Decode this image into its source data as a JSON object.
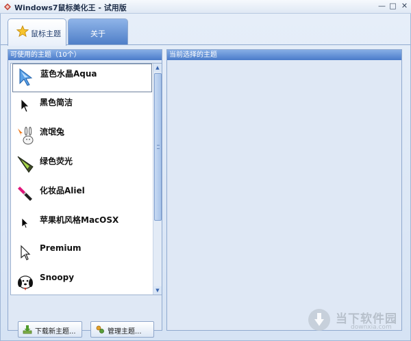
{
  "window": {
    "title": "Windows7鼠标美化王 - 试用版",
    "minimize_glyph": "—",
    "maximize_glyph": "□",
    "close_glyph": "✕"
  },
  "tabs": [
    {
      "label": "鼠标主题",
      "icon": "star-icon",
      "active": true
    },
    {
      "label": "关于",
      "active": false
    }
  ],
  "available_panel": {
    "header": "可使用的主题（10个）",
    "themes": [
      {
        "name": "蓝色水晶Aqua",
        "icon": "aqua-cursor-icon",
        "selected": true
      },
      {
        "name": "黑色简洁",
        "icon": "black-arrow-cursor-icon",
        "selected": false
      },
      {
        "name": "流氓兔",
        "icon": "rabbit-cursor-icon",
        "selected": false
      },
      {
        "name": "绿色荧光",
        "icon": "green-glow-cursor-icon",
        "selected": false
      },
      {
        "name": "化妆品Aliel",
        "icon": "lipstick-cursor-icon",
        "selected": false
      },
      {
        "name": "苹果机风格MacOSX",
        "icon": "macosx-cursor-icon",
        "selected": false
      },
      {
        "name": "Premium",
        "icon": "premium-cursor-icon",
        "selected": false
      },
      {
        "name": "Snoopy",
        "icon": "snoopy-cursor-icon",
        "selected": false
      }
    ],
    "scroll_up_glyph": "▲",
    "scroll_down_glyph": "▼",
    "buttons": {
      "download": "下载新主题...",
      "manage": "管理主题..."
    }
  },
  "current_panel": {
    "header": "当前选择的主题"
  },
  "watermark": {
    "brand": "当下软件园",
    "url": "downxia.com"
  },
  "colors": {
    "accent": "#4a7bc9",
    "panel_bg": "#dfe8f5",
    "tab_inactive": "#4f7fc8"
  }
}
